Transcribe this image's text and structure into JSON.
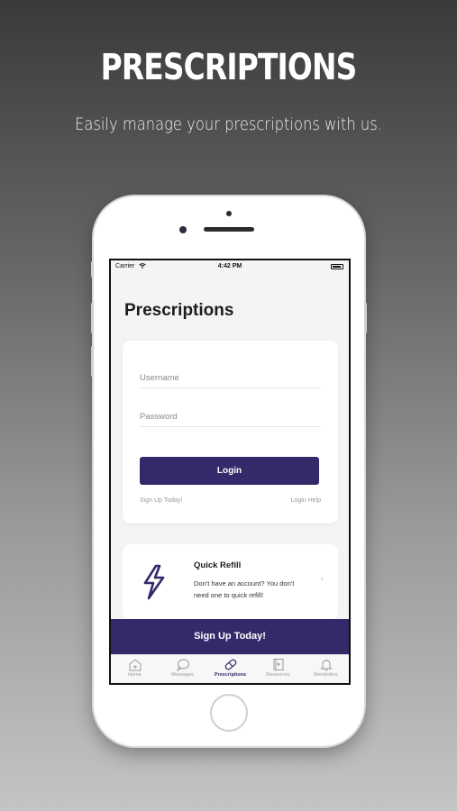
{
  "hero": {
    "title": "PRESCRIPTIONS",
    "subtitle": "Easily manage your prescriptions with us."
  },
  "status_bar": {
    "carrier": "Carrier",
    "time": "4:42 PM"
  },
  "page": {
    "title": "Prescriptions"
  },
  "login": {
    "username_placeholder": "Username",
    "username_value": "",
    "password_placeholder": "Password",
    "password_value": "",
    "login_label": "Login",
    "signup_link": "Sign Up Today!",
    "help_link": "Login Help"
  },
  "quick_refill": {
    "title": "Quick Refill",
    "description": "Don't have an account? You don't need one to quick refill!"
  },
  "banner": {
    "label": "Sign Up Today!"
  },
  "tabs": [
    {
      "label": "Home",
      "icon": "home-icon",
      "active": false
    },
    {
      "label": "Messages",
      "icon": "chat-bubble-icon",
      "active": false
    },
    {
      "label": "Prescriptions",
      "icon": "pill-icon",
      "active": true
    },
    {
      "label": "Resources",
      "icon": "book-icon",
      "active": false
    },
    {
      "label": "Reminders",
      "icon": "bell-icon",
      "active": false
    }
  ],
  "colors": {
    "brand": "#35296a",
    "background": "#f4f4f5"
  }
}
